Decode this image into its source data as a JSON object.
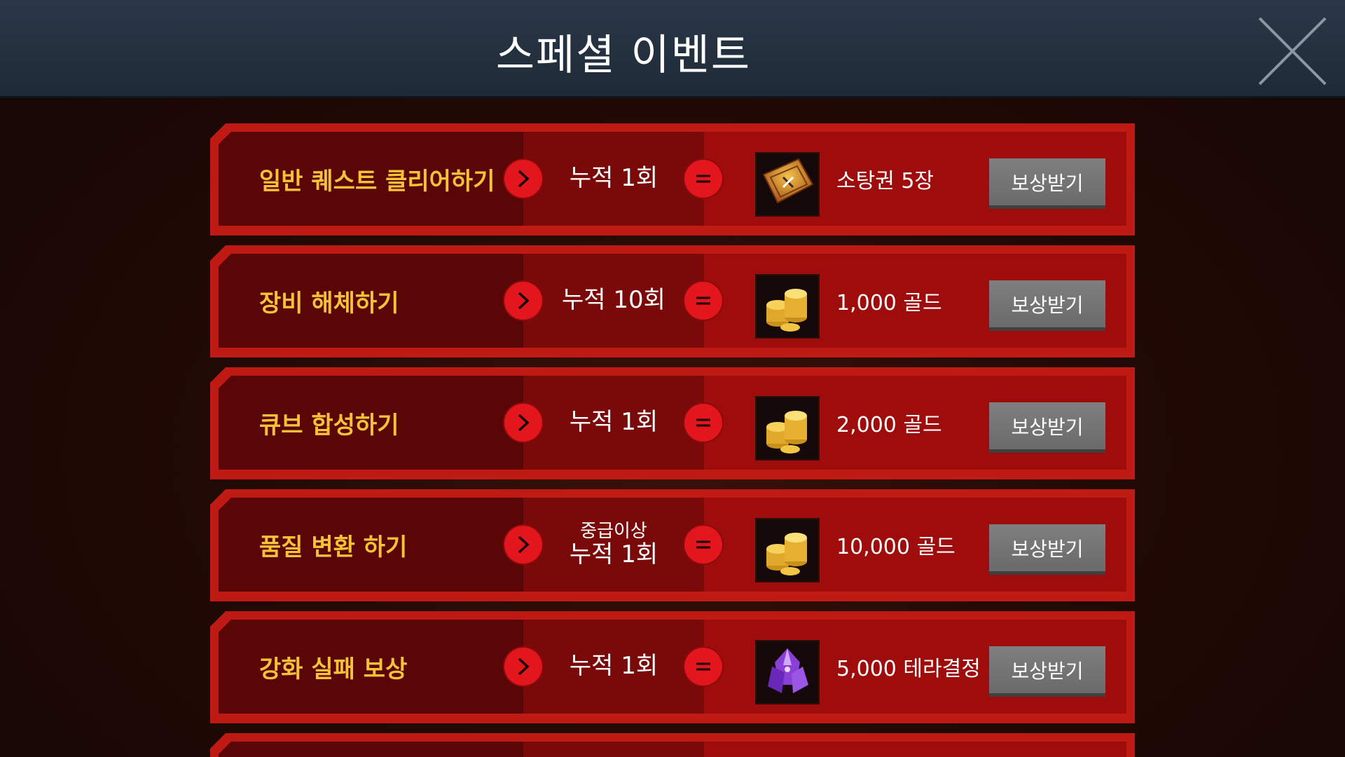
{
  "header": {
    "title": "스페셜 이벤트"
  },
  "colors": {
    "header_bg": "#1e2a37",
    "row_border": "#c01a14",
    "task_text": "#f6c238",
    "circle": "#e2161c",
    "button": "#757575"
  },
  "events": [
    {
      "task": "일반 퀘스트 클리어하기",
      "condition_sub": "",
      "condition": "누적 1회",
      "reward_icon": "ticket-icon",
      "reward": "소탕권 5장",
      "button": "보상받기"
    },
    {
      "task": "장비 해체하기",
      "condition_sub": "",
      "condition": "누적 10회",
      "reward_icon": "gold-coins-icon",
      "reward": "1,000 골드",
      "button": "보상받기"
    },
    {
      "task": "큐브 합성하기",
      "condition_sub": "",
      "condition": "누적 1회",
      "reward_icon": "gold-coins-icon",
      "reward": "2,000 골드",
      "button": "보상받기"
    },
    {
      "task": "품질 변환 하기",
      "condition_sub": "중급이상",
      "condition": "누적 1회",
      "reward_icon": "gold-coins-icon",
      "reward": "10,000 골드",
      "button": "보상받기"
    },
    {
      "task": "강화 실패 보상",
      "condition_sub": "",
      "condition": "누적 1회",
      "reward_icon": "purple-crystal-icon",
      "reward": "5,000 테라결정",
      "button": "보상받기"
    }
  ]
}
